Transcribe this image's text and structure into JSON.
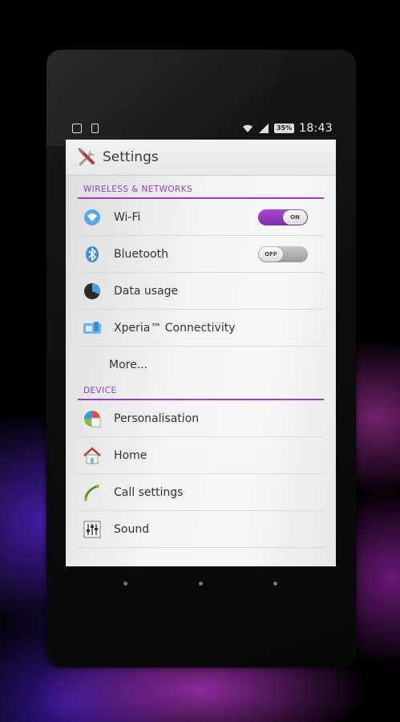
{
  "statusbar": {
    "battery": "35%",
    "time": "18:43"
  },
  "actionbar": {
    "title": "Settings",
    "icon": "settings-tools-icon"
  },
  "sections": {
    "wireless": {
      "header": "WIRELESS & NETWORKS",
      "items": [
        {
          "label": "Wi-Fi",
          "icon": "wifi-icon",
          "toggle": "ON"
        },
        {
          "label": "Bluetooth",
          "icon": "bluetooth-icon",
          "toggle": "OFF"
        },
        {
          "label": "Data usage",
          "icon": "data-usage-icon"
        },
        {
          "label": "Xperia™ Connectivity",
          "icon": "xperia-connectivity-icon"
        },
        {
          "label": "More..."
        }
      ]
    },
    "device": {
      "header": "DEVICE",
      "items": [
        {
          "label": "Personalisation",
          "icon": "personalisation-icon"
        },
        {
          "label": "Home",
          "icon": "home-icon"
        },
        {
          "label": "Call settings",
          "icon": "phone-icon"
        },
        {
          "label": "Sound",
          "icon": "sound-icon"
        }
      ]
    }
  },
  "colors": {
    "accent": "#9a3fc4",
    "toggle_on": "#8f3abb"
  }
}
